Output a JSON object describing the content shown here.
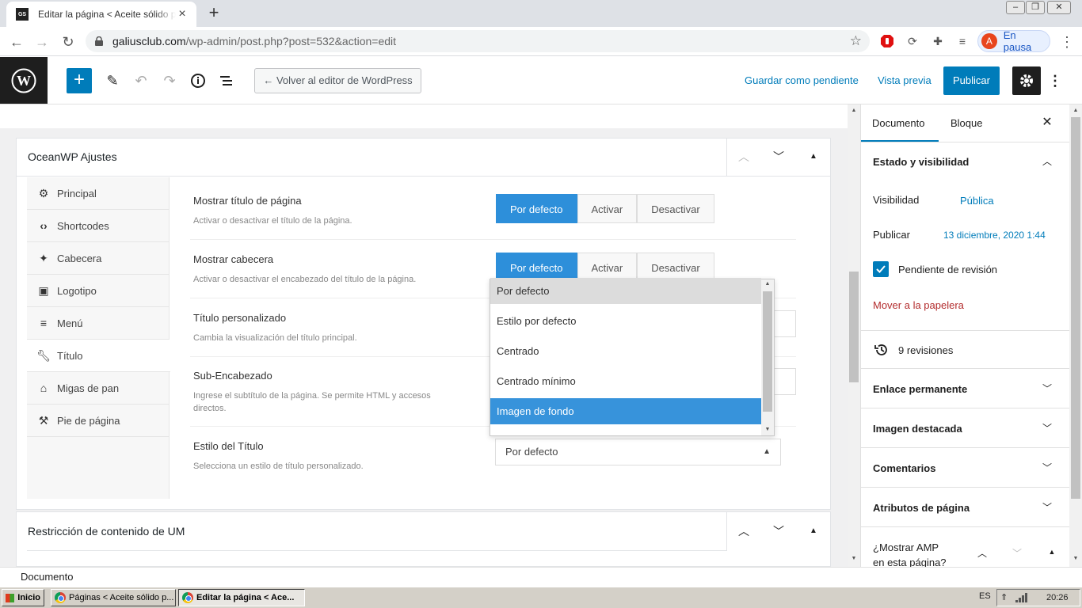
{
  "browser": {
    "tab_title": "Editar la página < Aceite sólido para",
    "tab_favicon": "GS",
    "url_domain": "galiusclub.com",
    "url_path": "/wp-admin/post.php?post=532&action=edit",
    "profile_initial": "A",
    "profile_status": "En pausa"
  },
  "editor_header": {
    "back_label": "← Volver al editor de WordPress",
    "save_pending_label": "Guardar como pendiente",
    "preview_label": "Vista previa",
    "publish_label": "Publicar"
  },
  "oceanwp": {
    "title": "OceanWP Ajustes",
    "nav": [
      {
        "label": "Principal",
        "icon": "gear-icon"
      },
      {
        "label": "Shortcodes",
        "icon": "code-icon"
      },
      {
        "label": "Cabecera",
        "icon": "pin-icon"
      },
      {
        "label": "Logotipo",
        "icon": "image-icon"
      },
      {
        "label": "Menú",
        "icon": "menu-icon"
      },
      {
        "label": "Título",
        "icon": "wrench-icon"
      },
      {
        "label": "Migas de pan",
        "icon": "home-icon"
      },
      {
        "label": "Pie de página",
        "icon": "hammer-icon"
      }
    ],
    "settings": {
      "show_title": {
        "label": "Mostrar título de página",
        "desc": "Activar o desactivar el título de la página."
      },
      "show_header": {
        "label": "Mostrar cabecera",
        "desc": "Activar o desactivar el encabezado del título de la página."
      },
      "custom_title": {
        "label": "Título personalizado",
        "desc": "Cambia la visualización del título principal."
      },
      "subheading": {
        "label": "Sub-Encabezado",
        "desc_line1": "Ingrese el subtítulo de la página. Se permite HTML y accesos",
        "desc_line2": "directos."
      },
      "title_style": {
        "label": "Estilo del Título",
        "desc": "Selecciona un estilo de título personalizado.",
        "value": "Por defecto"
      }
    },
    "toggle_options": [
      "Por defecto",
      "Activar",
      "Desactivar"
    ],
    "dropdown_options": [
      "Por defecto",
      "Estilo por defecto",
      "Centrado",
      "Centrado mínimo",
      "Imagen de fondo"
    ],
    "dropdown_hover": "Por defecto",
    "dropdown_selected": "Imagen de fondo"
  },
  "panel2": {
    "title": "Restricción de contenido de UM"
  },
  "sidebar": {
    "tab_document": "Documento",
    "tab_block": "Bloque",
    "status_heading": "Estado y visibilidad",
    "visibility_label": "Visibilidad",
    "visibility_value": "Pública",
    "publish_label": "Publicar",
    "publish_value": "13 diciembre, 2020 1:44",
    "pending_label": "Pendiente de revisión",
    "trash_label": "Mover a la papelera",
    "revisions_label": "9 revisiones",
    "sections": [
      "Enlace permanente",
      "Imagen destacada",
      "Comentarios",
      "Atributos de página"
    ],
    "amp_line1": "¿Mostrar AMP",
    "amp_line2": "en esta página?"
  },
  "footer": {
    "breadcrumb": "Documento"
  },
  "taskbar": {
    "start": "Inicio",
    "task1": "Páginas < Aceite sólido p...",
    "task2": "Editar la página < Ace...",
    "lang": "ES",
    "time": "20:26"
  },
  "colors": {
    "wp_blue": "#007cba",
    "oceanwp_blue": "#2d8fda",
    "trash_red": "#b32d2e"
  }
}
